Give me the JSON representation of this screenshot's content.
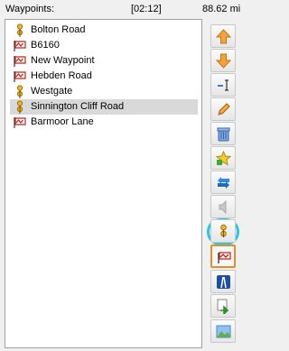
{
  "header": {
    "title": "Waypoints:",
    "time": "[02:12]",
    "distance": "88.62 mi"
  },
  "waypoints": [
    {
      "name": "Bolton Road",
      "icon": "pin-icon"
    },
    {
      "name": "B6160",
      "icon": "road-flag-icon"
    },
    {
      "name": "New Waypoint",
      "icon": "road-flag-icon"
    },
    {
      "name": "Hebden Road",
      "icon": "road-flag-icon"
    },
    {
      "name": "Westgate",
      "icon": "pin-icon"
    },
    {
      "name": "Sinnington Cliff Road",
      "icon": "pin-icon",
      "selected": true
    },
    {
      "name": "Barmoor Lane",
      "icon": "road-flag-icon"
    }
  ],
  "toolbar": [
    {
      "name": "move-up-button",
      "icon": "arrow-up-icon"
    },
    {
      "name": "move-down-button",
      "icon": "arrow-down-icon"
    },
    {
      "name": "rename-button",
      "icon": "text-cursor-icon"
    },
    {
      "name": "edit-button",
      "icon": "pencil-icon"
    },
    {
      "name": "delete-button",
      "icon": "trash-icon"
    },
    {
      "name": "favorite-button",
      "icon": "star-plus-icon"
    },
    {
      "name": "reverse-button",
      "icon": "swap-arrows-icon"
    },
    {
      "name": "voice-button",
      "icon": "speaker-icon"
    },
    {
      "name": "set-pin-button",
      "icon": "pin-icon",
      "highlighted": true
    },
    {
      "name": "set-road-button",
      "icon": "road-flag-icon",
      "focused": true
    },
    {
      "name": "motorway-button",
      "icon": "highway-icon"
    },
    {
      "name": "import-button",
      "icon": "import-arrow-icon"
    },
    {
      "name": "map-view-button",
      "icon": "landscape-icon"
    }
  ],
  "colors": {
    "selection": "#d9d9d9",
    "highlight_ring": "#25c8e0",
    "focus_border": "#e0902b"
  }
}
